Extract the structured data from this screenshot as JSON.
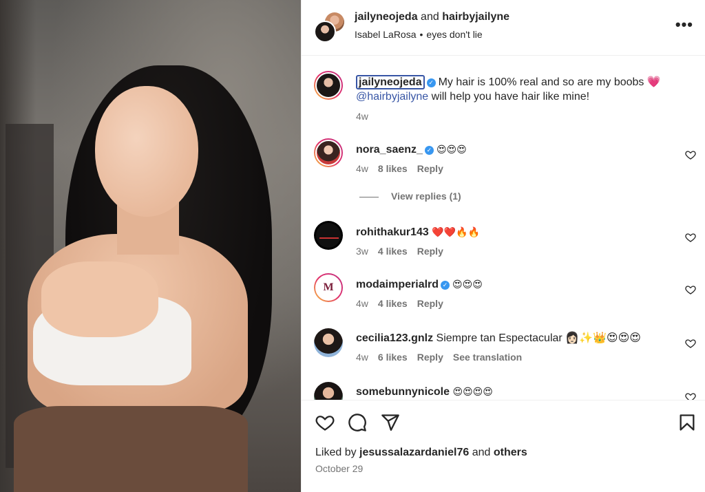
{
  "post": {
    "author": "jailyneojeda",
    "and_text": "and",
    "collaborator": "hairbyjailyne",
    "audio_artist": "Isabel LaRosa",
    "audio_separator": "•",
    "audio_title": "eyes don't lie",
    "more_label": "•••"
  },
  "caption": {
    "username": "jailyneojeda",
    "verified_glyph": "✓",
    "text_line1": "My hair is 100% real and so are my boobs 💗",
    "mention": "@hairbyjailyne",
    "text_line2": " will help you have hair like mine!",
    "time": "4w"
  },
  "comments": [
    {
      "username": "nora_saenz_",
      "verified": true,
      "text": "😍😍😍",
      "time": "4w",
      "likes": "8 likes",
      "reply": "Reply",
      "extra": ""
    },
    {
      "username": "rohithakur143",
      "verified": false,
      "text": "❤️❤️🔥🔥",
      "time": "3w",
      "likes": "4 likes",
      "reply": "Reply",
      "extra": ""
    },
    {
      "username": "modaimperialrd",
      "verified": true,
      "text": "😍😍😍",
      "time": "4w",
      "likes": "4 likes",
      "reply": "Reply",
      "extra": ""
    },
    {
      "username": "cecilia123.gnlz",
      "verified": false,
      "text": "Siempre tan Espectacular 👩🏻✨👑😍😍😍",
      "time": "4w",
      "likes": "6 likes",
      "reply": "Reply",
      "extra": "See translation"
    },
    {
      "username": "somebunnynicole",
      "verified": false,
      "text": "😍😍😍😍",
      "time": "",
      "likes": "",
      "reply": "",
      "extra": ""
    }
  ],
  "view_replies": "View replies (1)",
  "footer": {
    "liked_by_prefix": "Liked by",
    "liked_by_user": "jesussalazardaniel76",
    "and_text": "and",
    "others": "others",
    "date": "October 29"
  },
  "icons": {
    "like": "heart-icon",
    "comment": "comment-icon",
    "share": "share-icon",
    "save": "bookmark-icon",
    "more": "more-icon"
  },
  "colors": {
    "mention": "#3755a5",
    "verified": "#3897f0",
    "secondary_text": "#737373"
  }
}
